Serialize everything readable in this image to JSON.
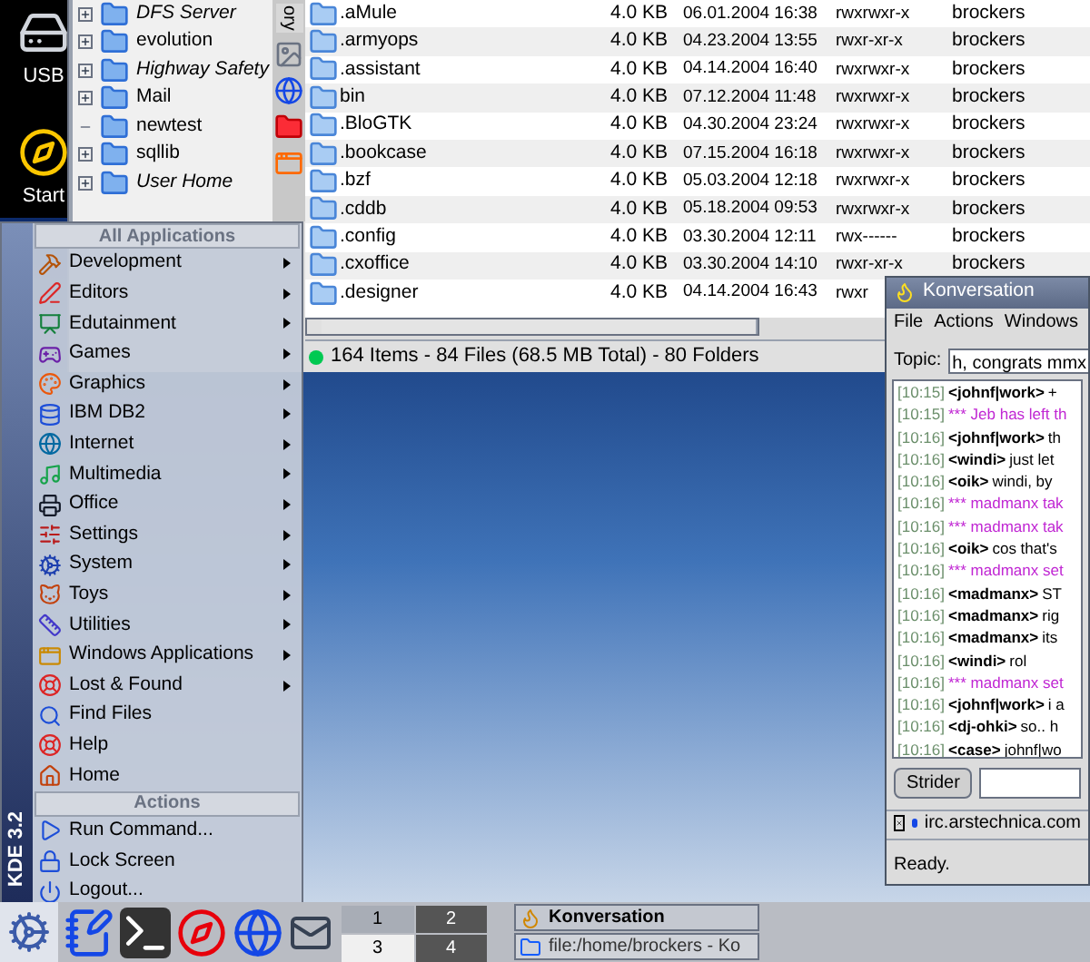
{
  "desktop_icons": [
    {
      "label": "USB"
    },
    {
      "label": "Start"
    }
  ],
  "file_manager": {
    "sidebar_tab": "ory",
    "tree": [
      {
        "label": "DFS Server",
        "italic": true,
        "expandable": true
      },
      {
        "label": "evolution",
        "italic": false,
        "expandable": true
      },
      {
        "label": "Highway Safety",
        "italic": true,
        "expandable": true
      },
      {
        "label": "Mail",
        "italic": false,
        "expandable": true
      },
      {
        "label": "newtest",
        "italic": false,
        "expandable": false
      },
      {
        "label": "sqllib",
        "italic": false,
        "expandable": true
      },
      {
        "label": "User Home",
        "italic": true,
        "expandable": true
      }
    ],
    "files": [
      {
        "name": ".aMule",
        "size": "4.0 KB",
        "date": "06.01.2004 16:38",
        "permissions": "rwxrwxr-x",
        "owner": "brockers"
      },
      {
        "name": ".armyops",
        "size": "4.0 KB",
        "date": "04.23.2004 13:55",
        "permissions": "rwxr-xr-x",
        "owner": "brockers"
      },
      {
        "name": ".assistant",
        "size": "4.0 KB",
        "date": "04.14.2004 16:40",
        "permissions": "rwxrwxr-x",
        "owner": "brockers"
      },
      {
        "name": "bin",
        "size": "4.0 KB",
        "date": "07.12.2004 11:48",
        "permissions": "rwxrwxr-x",
        "owner": "brockers"
      },
      {
        "name": ".BloGTK",
        "size": "4.0 KB",
        "date": "04.30.2004 23:24",
        "permissions": "rwxrwxr-x",
        "owner": "brockers"
      },
      {
        "name": ".bookcase",
        "size": "4.0 KB",
        "date": "07.15.2004 16:18",
        "permissions": "rwxrwxr-x",
        "owner": "brockers"
      },
      {
        "name": ".bzf",
        "size": "4.0 KB",
        "date": "05.03.2004 12:18",
        "permissions": "rwxrwxr-x",
        "owner": "brockers"
      },
      {
        "name": ".cddb",
        "size": "4.0 KB",
        "date": "05.18.2004 09:53",
        "permissions": "rwxrwxr-x",
        "owner": "brockers"
      },
      {
        "name": ".config",
        "size": "4.0 KB",
        "date": "03.30.2004 12:11",
        "permissions": "rwx------",
        "owner": "brockers"
      },
      {
        "name": ".cxoffice",
        "size": "4.0 KB",
        "date": "03.30.2004 14:10",
        "permissions": "rwxr-xr-x",
        "owner": "brockers"
      },
      {
        "name": ".designer",
        "size": "4.0 KB",
        "date": "04.14.2004 16:43",
        "permissions": "rwxr"
      }
    ],
    "status": "164 Items - 84 Files (68.5 MB Total) - 80 Folders"
  },
  "start_menu": {
    "side_label": "KDE 3.2",
    "sections": [
      {
        "title": "All Applications",
        "items": [
          {
            "label": "Development",
            "submenu": true
          },
          {
            "label": "Editors",
            "submenu": true
          },
          {
            "label": "Edutainment",
            "submenu": true
          },
          {
            "label": "Games",
            "submenu": true
          },
          {
            "label": "Graphics",
            "submenu": true
          },
          {
            "label": "IBM DB2",
            "submenu": true
          },
          {
            "label": "Internet",
            "submenu": true
          },
          {
            "label": "Multimedia",
            "submenu": true
          },
          {
            "label": "Office",
            "submenu": true
          },
          {
            "label": "Settings",
            "submenu": true
          },
          {
            "label": "System",
            "submenu": true
          },
          {
            "label": "Toys",
            "submenu": true
          },
          {
            "label": "Utilities",
            "submenu": true
          },
          {
            "label": "Windows Applications",
            "submenu": true
          },
          {
            "label": "Lost & Found",
            "submenu": true
          },
          {
            "label": "Find Files",
            "submenu": false
          },
          {
            "label": "Help",
            "submenu": false
          },
          {
            "label": "Home",
            "submenu": false
          }
        ]
      },
      {
        "title": "Actions",
        "items": [
          {
            "label": "Run Command...",
            "submenu": false
          },
          {
            "label": "Lock Screen",
            "submenu": false
          },
          {
            "label": "Logout...",
            "submenu": false
          }
        ]
      }
    ]
  },
  "chat_window": {
    "title": "Konversation",
    "menu": [
      "File",
      "Actions",
      "Windows"
    ],
    "topic_label": "Topic:",
    "topic": "h, congrats mmx",
    "lines": [
      {
        "kind": "message",
        "time": "[10:15]",
        "nick": "<johnf|work>",
        "text": "+"
      },
      {
        "kind": "event",
        "time": "[10:15]",
        "text": "*** Jeb has left th"
      },
      {
        "kind": "message",
        "time": "[10:16]",
        "nick": "<johnf|work>",
        "text": "th"
      },
      {
        "kind": "message",
        "time": "[10:16]",
        "nick": "<windi>",
        "text": "just let"
      },
      {
        "kind": "message",
        "time": "[10:16]",
        "nick": "<oik>",
        "text": "windi, by"
      },
      {
        "kind": "event",
        "time": "[10:16]",
        "text": "*** madmanx tak"
      },
      {
        "kind": "event",
        "time": "[10:16]",
        "text": "*** madmanx tak"
      },
      {
        "kind": "message",
        "time": "[10:16]",
        "nick": "<oik>",
        "text": "cos that's"
      },
      {
        "kind": "event",
        "time": "[10:16]",
        "text": "*** madmanx set"
      },
      {
        "kind": "message",
        "time": "[10:16]",
        "nick": "<madmanx>",
        "text": "ST"
      },
      {
        "kind": "message",
        "time": "[10:16]",
        "nick": "<madmanx>",
        "text": "rig"
      },
      {
        "kind": "message",
        "time": "[10:16]",
        "nick": "<madmanx>",
        "text": "its"
      },
      {
        "kind": "message",
        "time": "[10:16]",
        "nick": "<windi>",
        "text": "rol"
      },
      {
        "kind": "event",
        "time": "[10:16]",
        "text": "*** madmanx set"
      },
      {
        "kind": "message",
        "time": "[10:16]",
        "nick": "<johnf|work>",
        "text": "i a"
      },
      {
        "kind": "message",
        "time": "[10:16]",
        "nick": "<dj-ohki>",
        "text": "so.. h"
      },
      {
        "kind": "message",
        "time": "[10:16]",
        "nick": "<case>",
        "text": "johnf|wo"
      }
    ],
    "nick_button": "Strider",
    "server_tab": "irc.arstechnica.com",
    "status": "Ready."
  },
  "taskbar": {
    "pager": [
      {
        "label": "1",
        "selected": false
      },
      {
        "label": "2",
        "selected": false
      },
      {
        "label": "3",
        "selected": true
      },
      {
        "label": "4",
        "selected": false
      }
    ],
    "tasks": [
      {
        "label": "Konversation",
        "active": true
      },
      {
        "label": "file:/home/brockers - Ko",
        "active": false
      }
    ]
  }
}
